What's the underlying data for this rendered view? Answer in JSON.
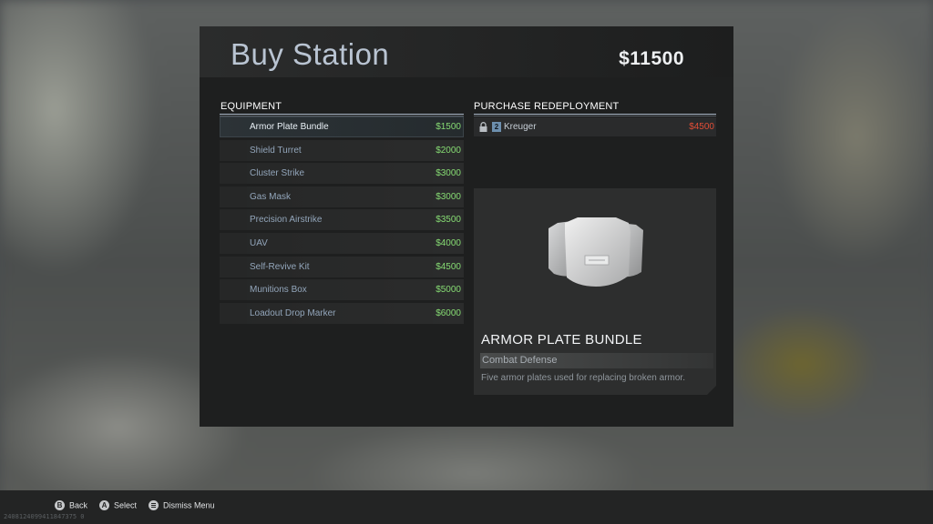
{
  "header": {
    "title": "Buy Station",
    "cash": "$11500"
  },
  "equipment": {
    "heading": "EQUIPMENT",
    "selected_index": 0,
    "items": [
      {
        "name": "Armor Plate Bundle",
        "price": "$1500"
      },
      {
        "name": "Shield Turret",
        "price": "$2000"
      },
      {
        "name": "Cluster Strike",
        "price": "$3000"
      },
      {
        "name": "Gas Mask",
        "price": "$3000"
      },
      {
        "name": "Precision Airstrike",
        "price": "$3500"
      },
      {
        "name": "UAV",
        "price": "$4000"
      },
      {
        "name": "Self-Revive Kit",
        "price": "$4500"
      },
      {
        "name": "Munitions Box",
        "price": "$5000"
      },
      {
        "name": "Loadout Drop Marker",
        "price": "$6000"
      }
    ]
  },
  "redeployment": {
    "heading": "PURCHASE REDEPLOYMENT",
    "player": {
      "level": "2",
      "name": "Kreuger",
      "price": "$4500",
      "icon": "lock-icon"
    }
  },
  "detail": {
    "name": "ARMOR PLATE BUNDLE",
    "category": "Combat Defense",
    "description": "Five armor plates used for replacing broken armor.",
    "image": "armor-plates-icon"
  },
  "footer": {
    "hints": [
      {
        "button": "B",
        "label": "Back"
      },
      {
        "button": "A",
        "label": "Select"
      },
      {
        "button": "menu",
        "label": "Dismiss Menu"
      }
    ],
    "build_id": "2408124099411847375 0"
  },
  "colors": {
    "price_green": "#86db73",
    "price_red": "#e14d36",
    "title_blue": "#b9c4d2"
  }
}
